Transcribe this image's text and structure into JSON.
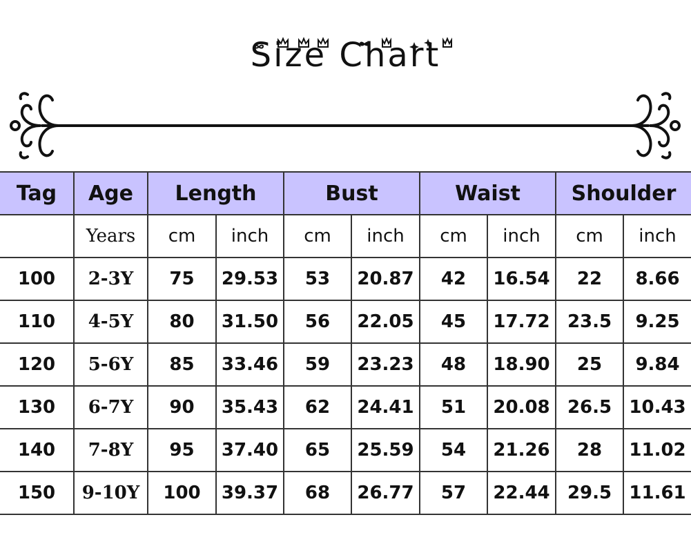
{
  "title": "Size Chart",
  "table": {
    "headers": [
      "Tag",
      "Age",
      "Length",
      "Bust",
      "Waist",
      "Shoulder"
    ],
    "units": {
      "age": "Years",
      "cm": "cm",
      "inch": "inch"
    },
    "rows": [
      {
        "tag": "100",
        "age": "2-3Y",
        "length_cm": "75",
        "length_inch": "29.53",
        "bust_cm": "53",
        "bust_inch": "20.87",
        "waist_cm": "42",
        "waist_inch": "16.54",
        "shoulder_cm": "22",
        "shoulder_inch": "8.66"
      },
      {
        "tag": "110",
        "age": "4-5Y",
        "length_cm": "80",
        "length_inch": "31.50",
        "bust_cm": "56",
        "bust_inch": "22.05",
        "waist_cm": "45",
        "waist_inch": "17.72",
        "shoulder_cm": "23.5",
        "shoulder_inch": "9.25"
      },
      {
        "tag": "120",
        "age": "5-6Y",
        "length_cm": "85",
        "length_inch": "33.46",
        "bust_cm": "59",
        "bust_inch": "23.23",
        "waist_cm": "48",
        "waist_inch": "18.90",
        "shoulder_cm": "25",
        "shoulder_inch": "9.84"
      },
      {
        "tag": "130",
        "age": "6-7Y",
        "length_cm": "90",
        "length_inch": "35.43",
        "bust_cm": "62",
        "bust_inch": "24.41",
        "waist_cm": "51",
        "waist_inch": "20.08",
        "shoulder_cm": "26.5",
        "shoulder_inch": "10.43"
      },
      {
        "tag": "140",
        "age": "7-8Y",
        "length_cm": "95",
        "length_inch": "37.40",
        "bust_cm": "65",
        "bust_inch": "25.59",
        "waist_cm": "54",
        "waist_inch": "21.26",
        "shoulder_cm": "28",
        "shoulder_inch": "11.02"
      },
      {
        "tag": "150",
        "age": "9-10Y",
        "length_cm": "100",
        "length_inch": "39.37",
        "bust_cm": "68",
        "bust_inch": "26.77",
        "waist_cm": "57",
        "waist_inch": "22.44",
        "shoulder_cm": "29.5",
        "shoulder_inch": "11.61"
      }
    ]
  },
  "colors": {
    "header_bg": "#c9c3ff",
    "border": "#333333",
    "text": "#111111"
  },
  "icons": [
    "bow-icon",
    "crown-icon",
    "sparkle-icon",
    "flourish-ornament-icon"
  ]
}
